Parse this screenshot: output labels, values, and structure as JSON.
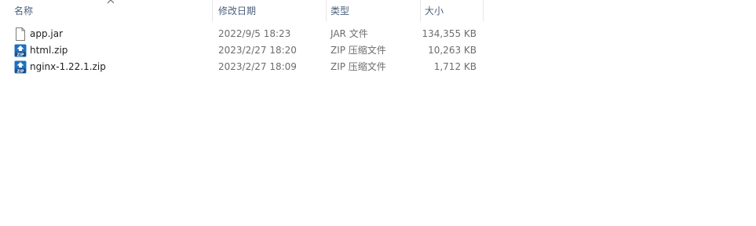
{
  "columns": {
    "name": "名称",
    "date": "修改日期",
    "type": "类型",
    "size": "大小"
  },
  "files": [
    {
      "name": "app.jar",
      "date": "2022/9/5 18:23",
      "type": "JAR 文件",
      "size": "134,355 KB",
      "icon": "file-icon"
    },
    {
      "name": "html.zip",
      "date": "2023/2/27 18:20",
      "type": "ZIP 压缩文件",
      "size": "10,263 KB",
      "icon": "zip-archive-icon"
    },
    {
      "name": "nginx-1.22.1.zip",
      "date": "2023/2/27 18:09",
      "type": "ZIP 压缩文件",
      "size": "1,712 KB",
      "icon": "zip-archive-icon"
    }
  ],
  "colors": {
    "header_text": "#4c607a",
    "date_type_text": "#6d6d6d",
    "zip_icon_blue": "#1e6fc0"
  }
}
